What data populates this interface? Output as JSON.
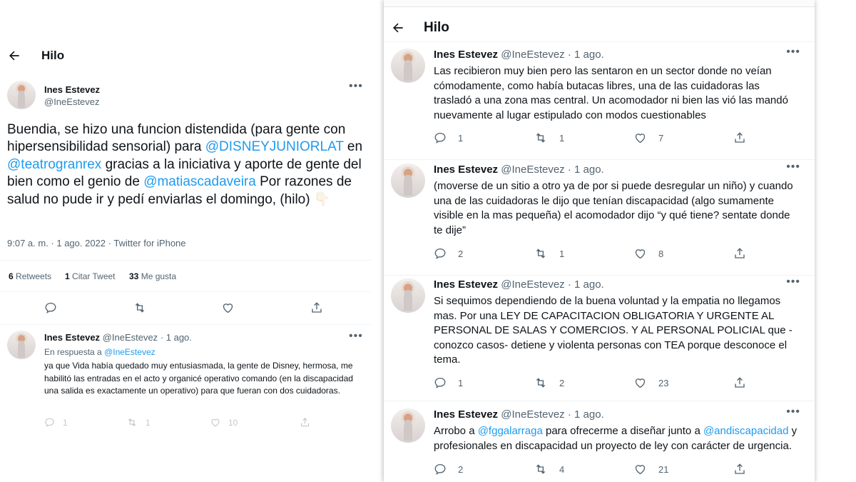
{
  "left": {
    "header": {
      "title": "Hilo"
    },
    "main_tweet": {
      "author_name": "Ines Estevez",
      "author_handle": "@IneEstevez",
      "text_parts": [
        "Buendia, se hizo una funcion distendida (para gente con hipersensibilidad sensorial) para ",
        "@DISNEYJUNIORLAT",
        " en ",
        "@teatrogranrex",
        " gracias a la iniciativa y aporte de gente del bien como el genio de ",
        "@matiascadaveira",
        " Por razones de salud no pude ir y pedí enviarlas el domingo, (hilo) ",
        "👇🏻"
      ],
      "meta": "9:07 a. m. · 1 ago. 2022 · Twitter for iPhone",
      "stats": {
        "retweets_count": "6",
        "retweets_label": "Retweets",
        "quotes_count": "1",
        "quotes_label": "Citar Tweet",
        "likes_count": "33",
        "likes_label": "Me gusta"
      }
    },
    "reply": {
      "author_name": "Ines Estevez",
      "author_handle": "@IneEstevez",
      "time": "· 1 ago.",
      "reply_to_label": "En respuesta a",
      "reply_to_handle": "@IneEstevez",
      "text": "ya que Vida había quedado muy entusiasmada, la gente de Disney, hermosa, me habilitó las entradas en el acto y organicé operativo comando (en la discapacidad una salida es exactamente un operativo) para que fueran con dos cuidadoras.",
      "replies": "1",
      "retweets": "1",
      "likes": "10"
    }
  },
  "right": {
    "header": {
      "title": "Hilo"
    },
    "tweets": [
      {
        "author_name": "Ines Estevez",
        "author_handle": "@IneEstevez",
        "time": "· 1 ago.",
        "text_parts": [
          "Las recibieron muy bien pero las sentaron en un sector donde no veían cómodamente, como había butacas libres, una de las cuidadoras las trasladó a una zona mas central. Un acomodador ni bien las vió las mandó nuevamente al lugar estipulado con modos cuestionables"
        ],
        "replies": "1",
        "retweets": "1",
        "likes": "7"
      },
      {
        "author_name": "Ines Estevez",
        "author_handle": "@IneEstevez",
        "time": "· 1 ago.",
        "text_parts": [
          "(moverse de un sitio a otro ya de por si puede desregular un niño) y cuando una de las cuidadoras le dijo que tenían discapacidad (algo sumamente visible en la mas pequeña) el acomodador dijo “y qué tiene? sentate donde te dije”"
        ],
        "replies": "2",
        "retweets": "1",
        "likes": "8"
      },
      {
        "author_name": "Ines Estevez",
        "author_handle": "@IneEstevez",
        "time": "· 1 ago.",
        "text_parts": [
          "Si sequimos dependiendo de la buena voluntad y la empatia no llegamos mas. Por una LEY DE CAPACITACION OBLIGATORIA Y URGENTE AL PERSONAL DE SALAS Y COMERCIOS. Y AL PERSONAL POLICIAL que -conozco casos- detiene y violenta personas con TEA porque desconoce el tema."
        ],
        "replies": "1",
        "retweets": "2",
        "likes": "23"
      },
      {
        "author_name": "Ines Estevez",
        "author_handle": "@IneEstevez",
        "time": "· 1 ago.",
        "text_parts": [
          "Arrobo a ",
          "@fggalarraga",
          " para ofrecerme a diseñar junto a ",
          "@andiscapacidad",
          " y profesionales en discapacidad un proyecto de ley con carácter de urgencia."
        ],
        "replies": "2",
        "retweets": "4",
        "likes": "21"
      }
    ]
  },
  "icons": {
    "back": "arrow-left-icon",
    "more": "more-horizontal-icon",
    "reply": "reply-bubble-icon",
    "retweet": "retweet-icon",
    "like": "heart-icon",
    "share": "share-icon"
  },
  "colors": {
    "link_blue": "#1d9bf0",
    "secondary_text": "#536471",
    "primary_text": "#0f1419"
  }
}
